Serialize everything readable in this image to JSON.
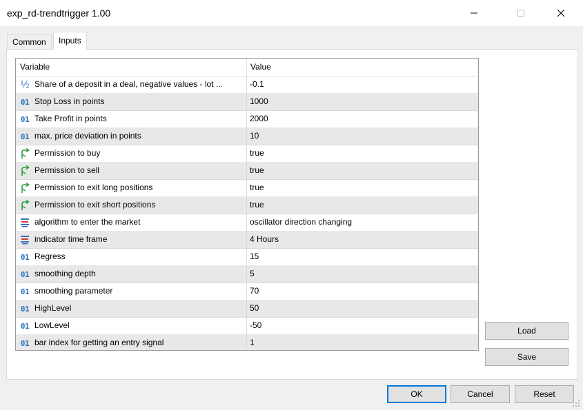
{
  "window": {
    "title": "exp_rd-trendtrigger 1.00"
  },
  "tabs": [
    {
      "label": "Common",
      "active": false
    },
    {
      "label": "Inputs",
      "active": true
    }
  ],
  "table": {
    "columns": [
      "Variable",
      "Value"
    ],
    "rows": [
      {
        "icon": "fraction-icon",
        "variable": "Share of a deposit in a deal, negative values - lot ...",
        "value": "-0.1"
      },
      {
        "icon": "integer-icon",
        "variable": "Stop Loss in points",
        "value": "1000"
      },
      {
        "icon": "integer-icon",
        "variable": "Take Profit in points",
        "value": "2000"
      },
      {
        "icon": "integer-icon",
        "variable": "max. price deviation in points",
        "value": "10"
      },
      {
        "icon": "bool-arrow-icon",
        "variable": "Permission to buy",
        "value": "true"
      },
      {
        "icon": "bool-arrow-icon",
        "variable": "Permission to sell",
        "value": "true"
      },
      {
        "icon": "bool-arrow-icon",
        "variable": "Permission to exit long positions",
        "value": "true"
      },
      {
        "icon": "bool-arrow-icon",
        "variable": "Permission to exit short positions",
        "value": "true"
      },
      {
        "icon": "enum-icon",
        "variable": "algorithm to enter the market",
        "value": "oscillator direction changing"
      },
      {
        "icon": "enum-icon",
        "variable": "indicator time frame",
        "value": "4 Hours"
      },
      {
        "icon": "integer-icon",
        "variable": "Regress",
        "value": "15"
      },
      {
        "icon": "integer-icon",
        "variable": "smoothing depth",
        "value": "5"
      },
      {
        "icon": "integer-icon",
        "variable": "smoothing parameter",
        "value": "70"
      },
      {
        "icon": "integer-icon",
        "variable": "HighLevel",
        "value": "50"
      },
      {
        "icon": "integer-icon",
        "variable": "LowLevel",
        "value": "-50"
      },
      {
        "icon": "integer-icon",
        "variable": "bar index for getting an entry signal",
        "value": "1"
      }
    ]
  },
  "side_buttons": {
    "load": "Load",
    "save": "Save"
  },
  "footer_buttons": {
    "ok": "OK",
    "cancel": "Cancel",
    "reset": "Reset"
  },
  "colors": {
    "accent": "#0078d7",
    "integer_icon": "#2a73c0",
    "bool_icon": "#2e9e3a",
    "enum_icon_blue": "#3b74c4",
    "enum_icon_red": "#d23b3b"
  }
}
